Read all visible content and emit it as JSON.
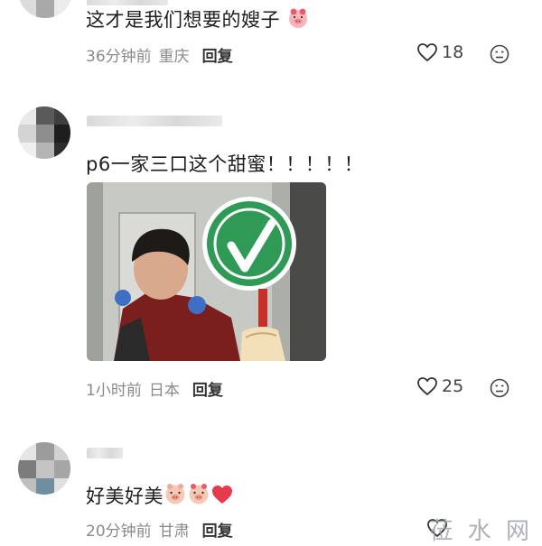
{
  "comments": [
    {
      "text": "这才是我们想要的嫂子",
      "time": "36分钟前",
      "location": "重庆",
      "reply_label": "回复",
      "likes": "18"
    },
    {
      "text": "p6一家三口这个甜蜜！！！！！",
      "time": "1小时前",
      "location": "日本",
      "reply_label": "回复",
      "likes": "25"
    },
    {
      "text": "好美好美",
      "time": "20分钟前",
      "location": "甘肃",
      "reply_label": "回复",
      "likes": ""
    }
  ],
  "watermark": "莅 水 网",
  "icons": {
    "like": "heart-outline-icon",
    "dislike": "frown-face-icon",
    "pig_emoji": "pig-face-emoji",
    "heart_emoji": "red-heart-emoji"
  },
  "colors": {
    "text": "#1e1e1e",
    "meta": "#8a8a8a",
    "check_green": "#2f9a55",
    "heart_red": "#e83a4d"
  }
}
